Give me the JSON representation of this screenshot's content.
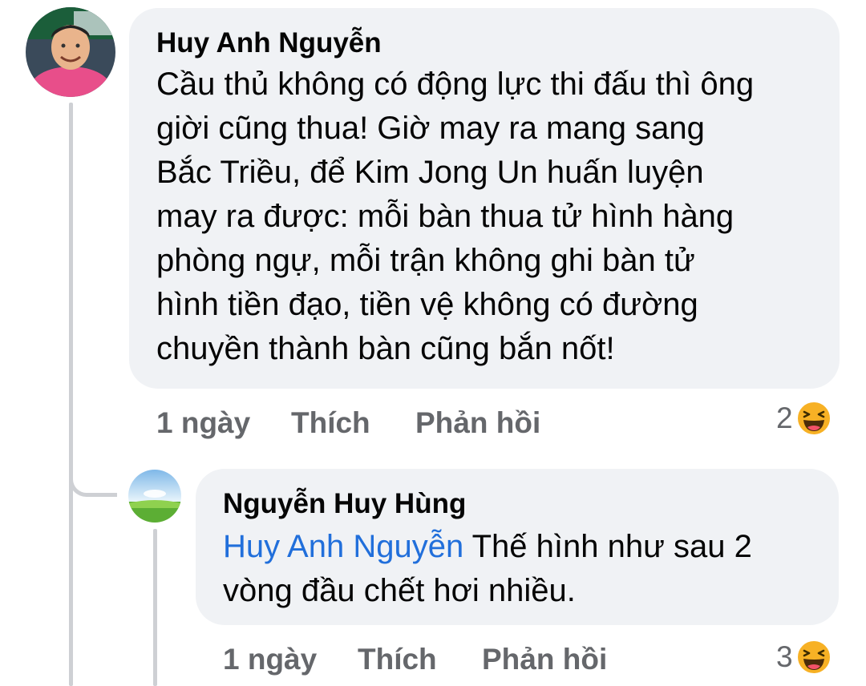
{
  "comment": {
    "author": "Huy Anh Nguyễn",
    "text_lines": [
      "Cầu thủ không có động lực thi đấu thì ông",
      "giời cũng thua! Giờ may ra mang sang",
      "Bắc Triều, để Kim Jong Un huấn luyện",
      "may ra được: mỗi bàn thua tử hình hàng",
      "phòng ngự, mỗi trận không ghi bàn tử",
      "hình tiền đạo, tiền vệ không có đường",
      "chuyền thành bàn cũng bắn nốt!"
    ],
    "time": "1 ngày",
    "like_label": "Thích",
    "reply_label": "Phản hồi",
    "reaction_count": "2",
    "reaction_icon": "haha-emoji-icon"
  },
  "reply": {
    "author": "Nguyễn Huy Hùng",
    "mention": "Huy Anh Nguyễn",
    "text_first": " Thế hình như sau 2",
    "text_second": "vòng đầu chết hơi nhiều.",
    "time": "1 ngày",
    "like_label": "Thích",
    "reply_label": "Phản hồi",
    "reaction_count": "3",
    "reaction_icon": "haha-emoji-icon"
  },
  "colors": {
    "bubble": "#f0f2f5",
    "mention": "#216fdb",
    "meta_text": "#65676b",
    "thread_line": "#ced0d4"
  }
}
